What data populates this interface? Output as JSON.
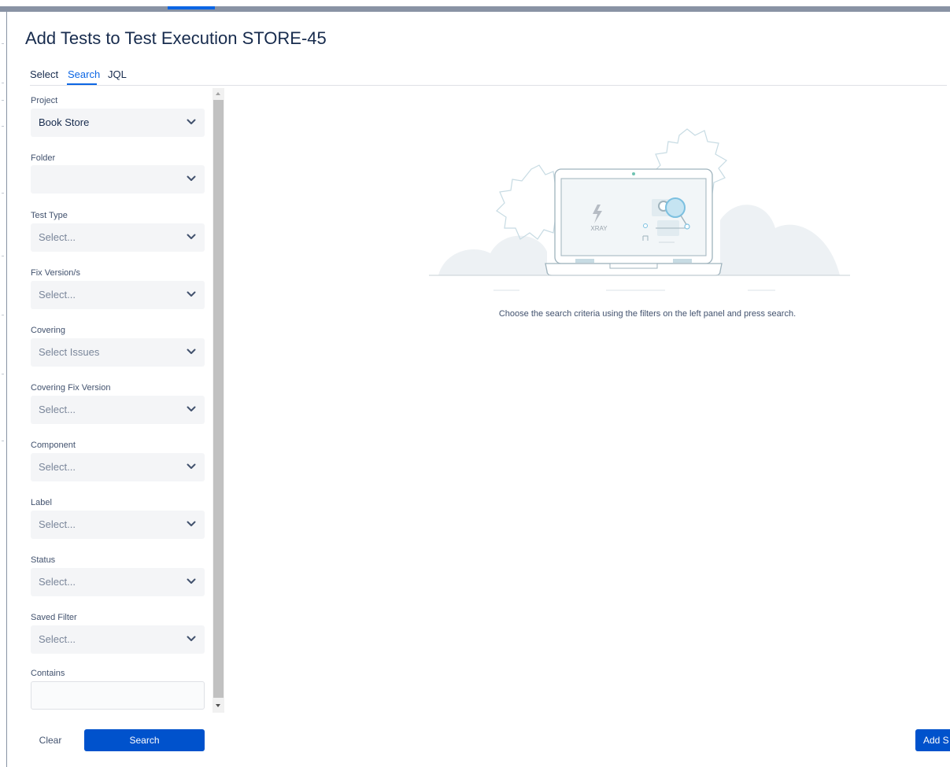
{
  "dialog": {
    "title": "Add Tests to Test Execution STORE-45"
  },
  "tabs": [
    {
      "label": "Select",
      "active": false
    },
    {
      "label": "Search",
      "active": true
    },
    {
      "label": "JQL",
      "active": false
    }
  ],
  "filters": {
    "project": {
      "label": "Project",
      "value": "Book Store"
    },
    "folder": {
      "label": "Folder",
      "value": ""
    },
    "test_type": {
      "label": "Test Type",
      "placeholder": "Select..."
    },
    "fix_versions": {
      "label": "Fix Version/s",
      "placeholder": "Select..."
    },
    "covering": {
      "label": "Covering",
      "placeholder": "Select Issues"
    },
    "covering_fix_version": {
      "label": "Covering Fix Version",
      "placeholder": "Select..."
    },
    "component": {
      "label": "Component",
      "placeholder": "Select..."
    },
    "label": {
      "label": "Label",
      "placeholder": "Select..."
    },
    "status": {
      "label": "Status",
      "placeholder": "Select..."
    },
    "saved_filter": {
      "label": "Saved Filter",
      "placeholder": "Select..."
    },
    "contains": {
      "label": "Contains",
      "value": ""
    }
  },
  "illustration": {
    "brand": "XRAY"
  },
  "empty_state": {
    "message": "Choose the search criteria using the filters on the left panel and press search."
  },
  "footer": {
    "clear_label": "Clear",
    "search_label": "Search",
    "add_label": "Add S"
  },
  "colors": {
    "primary": "#0052cc",
    "accent": "#0c66e4",
    "field_bg": "#f4f5f7"
  },
  "icons": {
    "dropdown": "chevron-down-icon"
  }
}
